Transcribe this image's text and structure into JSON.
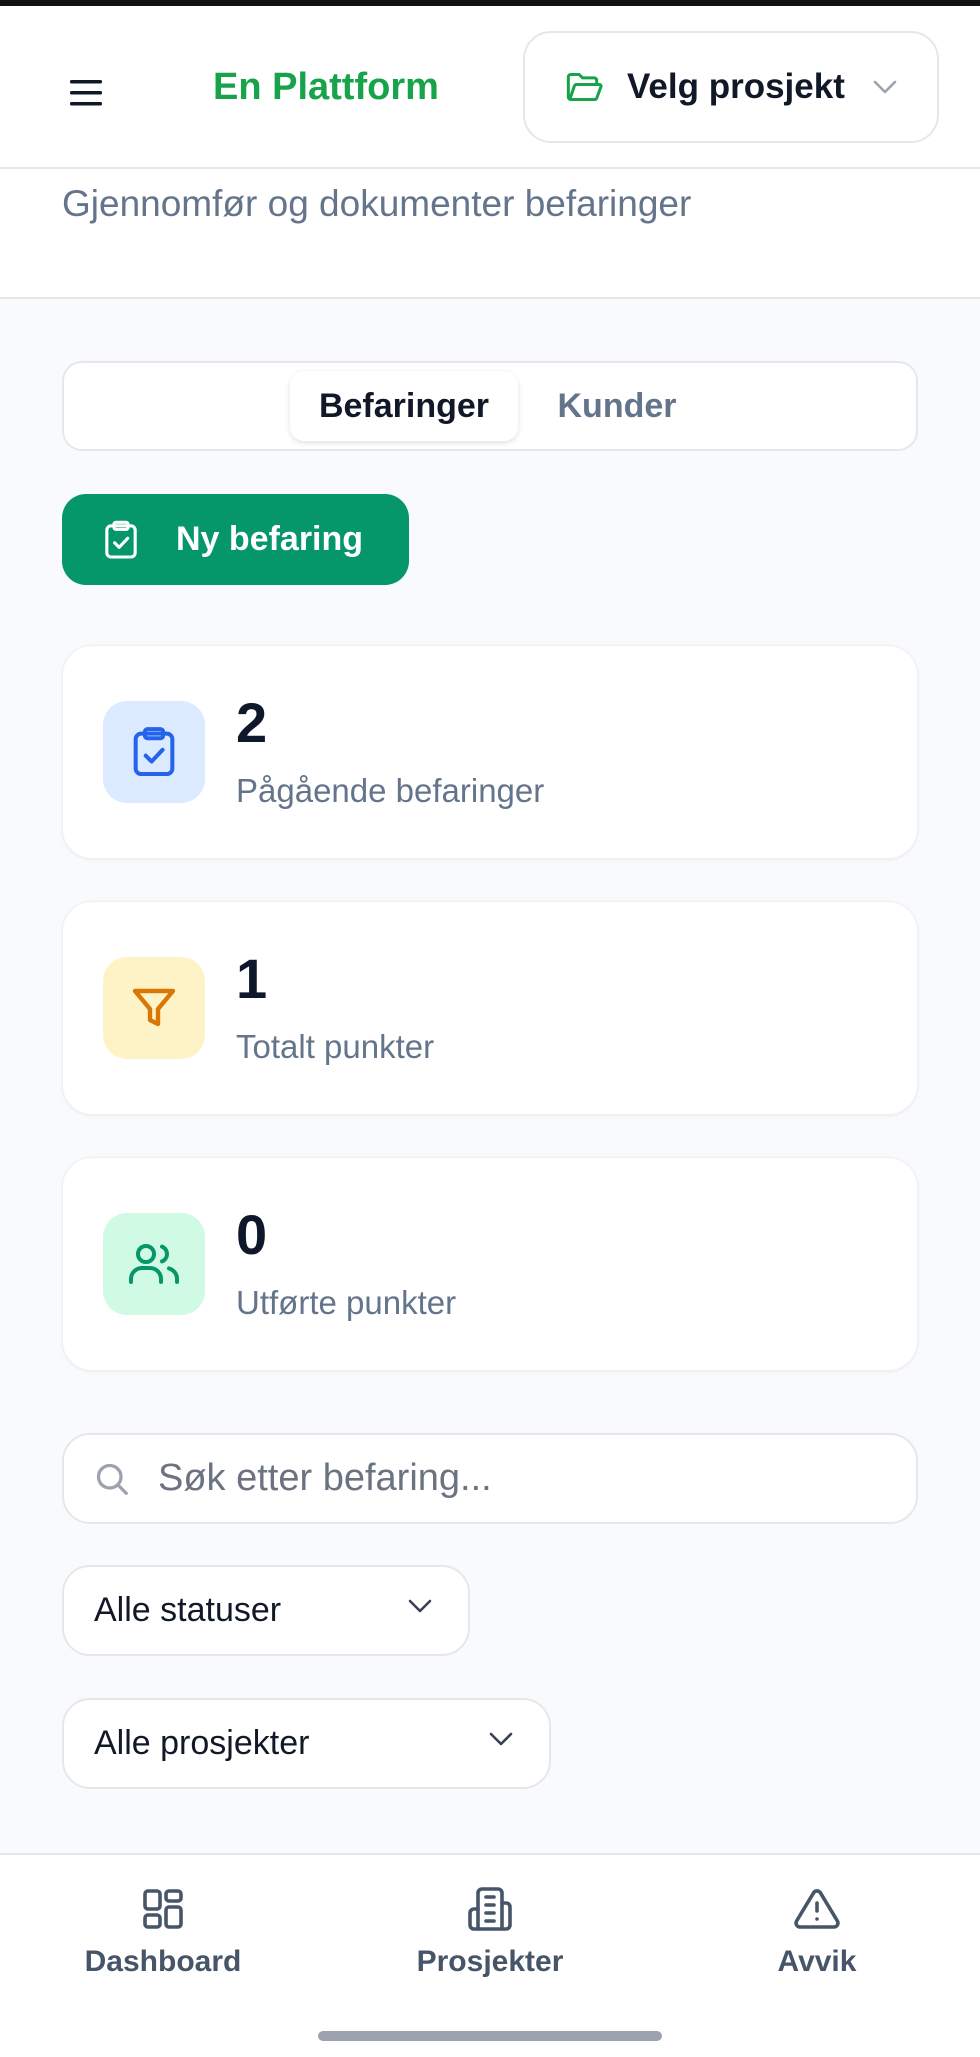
{
  "header": {
    "brand": "En Plattform",
    "project_select_label": "Velg prosjekt"
  },
  "page": {
    "subtitle": "Gjennomfør og dokumenter befaringer"
  },
  "tabs": [
    {
      "label": "Befaringer",
      "active": true
    },
    {
      "label": "Kunder",
      "active": false
    }
  ],
  "actions": {
    "new_inspection_label": "Ny befaring"
  },
  "stats": [
    {
      "value": "2",
      "label": "Pågående befaringer",
      "icon": "clipboard-check-icon",
      "color": "#2563eb",
      "bg": "#dbeafe"
    },
    {
      "value": "1",
      "label": "Totalt punkter",
      "icon": "filter-icon",
      "color": "#d97706",
      "bg": "#fef3c7"
    },
    {
      "value": "0",
      "label": "Utførte punkter",
      "icon": "users-icon",
      "color": "#059669",
      "bg": "#d1fae5"
    }
  ],
  "search": {
    "placeholder": "Søk etter befaring..."
  },
  "filters": {
    "status_selected": "Alle statuser",
    "project_selected": "Alle prosjekter"
  },
  "bottom_nav": [
    {
      "label": "Dashboard",
      "icon": "dashboard-grid-icon"
    },
    {
      "label": "Prosjekter",
      "icon": "building-icon"
    },
    {
      "label": "Avvik",
      "icon": "warning-triangle-icon"
    }
  ],
  "colors": {
    "brand": "#16a34a",
    "primary_button": "#059669",
    "muted_text": "#64748b"
  }
}
